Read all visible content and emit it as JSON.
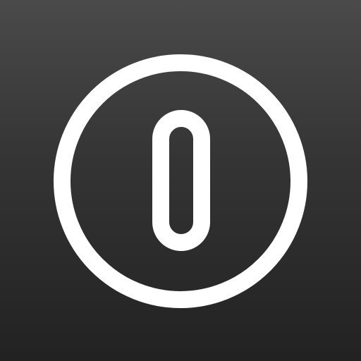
{
  "icon": {
    "name": "power-toggle-icon",
    "colors": {
      "background_top": "#4a4a4a",
      "background_bottom": "#222222",
      "stroke": "#ffffff"
    }
  }
}
